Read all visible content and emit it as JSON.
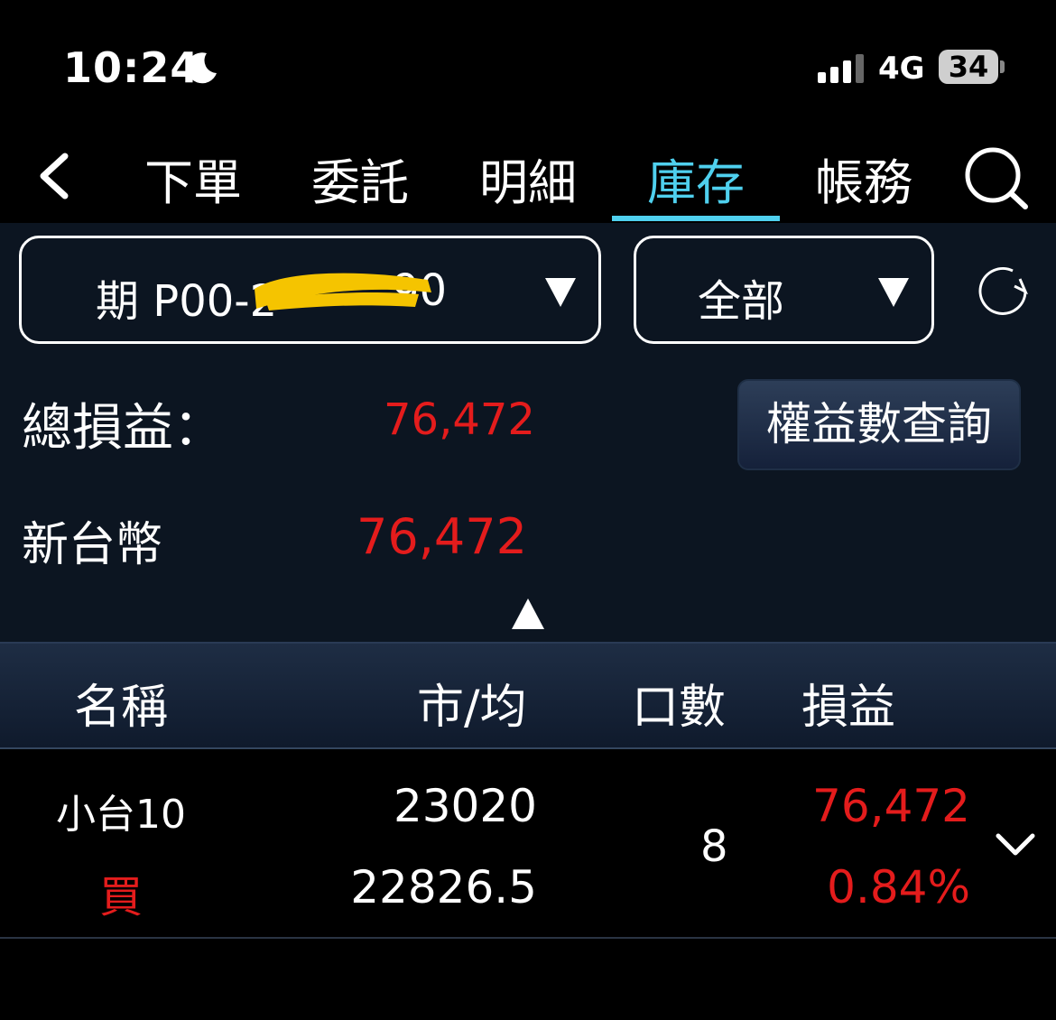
{
  "status": {
    "time": "10:24",
    "network": "4G",
    "battery": "34",
    "icons": [
      "moon-icon",
      "signal-icon",
      "battery-icon"
    ]
  },
  "nav": {
    "back_icon": "chevron-left-icon",
    "tabs": [
      {
        "label": "下單",
        "active": false
      },
      {
        "label": "委託",
        "active": false
      },
      {
        "label": "明細",
        "active": false
      },
      {
        "label": "庫存",
        "active": true
      },
      {
        "label": "帳務",
        "active": false
      }
    ],
    "search_icon": "search-icon",
    "accent": "#4fd0ee"
  },
  "filters": {
    "account_prefix": "期 P00-2",
    "account_suffix": "90",
    "scope": "全部",
    "refresh_icon": "refresh-icon"
  },
  "summary": {
    "total_label": "總損益：",
    "total_value": "76,472",
    "equity_button": "權益數查詢",
    "currency_label": "新台幣",
    "currency_value": "76,472",
    "loss_gain_color": "#e41c1c"
  },
  "table": {
    "headers": {
      "name": "名稱",
      "price": "市/均",
      "qty": "口數",
      "pnl": "損益"
    },
    "rows": [
      {
        "name": "小台10",
        "side": "買",
        "market_price": "23020",
        "avg_price": "22826.5",
        "qty": "8",
        "pnl": "76,472",
        "pnl_pct": "0.84%"
      }
    ]
  }
}
